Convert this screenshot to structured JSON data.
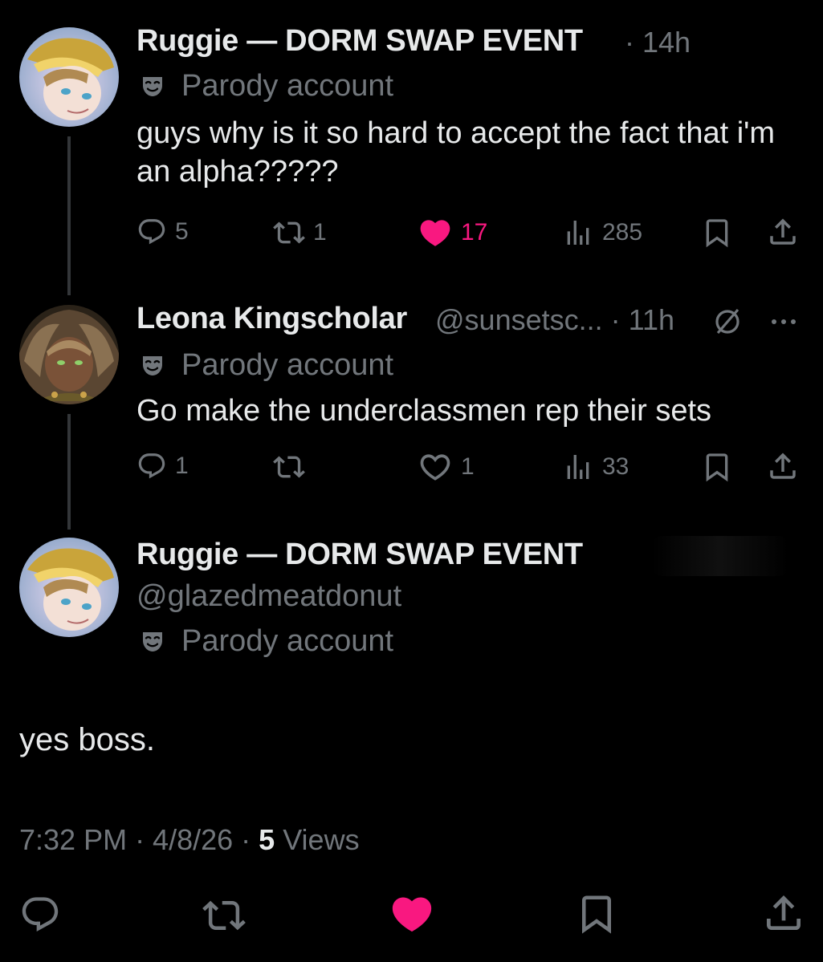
{
  "tweets": [
    {
      "name": "Ruggie — DORM SWAP EVENT",
      "time": "· 14h",
      "parody": "Parody account",
      "text": "guys why is it so hard to accept the fact that i'm an alpha?????",
      "replies": "5",
      "reposts": "1",
      "likes": "17",
      "views": "285",
      "liked": true
    },
    {
      "name": "Leona Kingscholar",
      "handle_time": "@sunsetsc... · 11h",
      "parody": "Parody account",
      "text": "Go make the underclassmen rep their sets",
      "replies": "1",
      "reposts": "",
      "likes": "1",
      "views": "33",
      "liked": false
    }
  ],
  "main_tweet": {
    "name": "Ruggie — DORM SWAP EVENT",
    "handle": "@glazedmeatdonut",
    "parody": "Parody account",
    "text": "yes boss.",
    "time": "7:32 PM · 4/8/26 · ",
    "views_count": "5",
    "views_label": " Views",
    "liked": true
  },
  "icons": {
    "reply": "reply-icon",
    "repost": "repost-icon",
    "like": "heart-icon",
    "views": "views-icon",
    "bookmark": "bookmark-icon",
    "share": "share-icon",
    "parody": "mask-icon",
    "more": "more-icon",
    "grok": "slash-circle-icon"
  },
  "colors": {
    "background": "#000000",
    "text": "#e7e9ea",
    "muted": "#71767b",
    "like": "#f91880",
    "thread_line": "#333639"
  }
}
